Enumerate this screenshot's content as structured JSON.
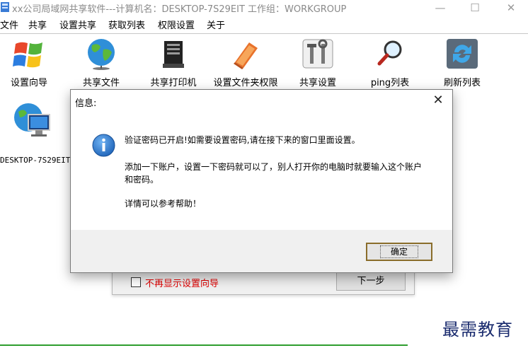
{
  "window": {
    "title": "xx公司局域网共享软件---计算机名：DESKTOP-7S29EIT   工作组：WORKGROUP",
    "minimize": "—",
    "maximize": "☐",
    "close": "✕"
  },
  "menu": [
    "文件",
    "共享",
    "设置共享",
    "获取列表",
    "权限设置",
    "关于"
  ],
  "toolbar": [
    {
      "label": "设置向导",
      "icon": "windows-logo-icon"
    },
    {
      "label": "共享文件",
      "icon": "globe-icon"
    },
    {
      "label": "共享打印机",
      "icon": "server-printer-icon"
    },
    {
      "label": "设置文件夹权限",
      "icon": "folder-book-icon"
    },
    {
      "label": "共享设置",
      "icon": "tools-icon"
    },
    {
      "label": "ping列表",
      "icon": "magnifier-icon"
    },
    {
      "label": "刷新列表",
      "icon": "refresh-icon"
    }
  ],
  "computers": [
    {
      "name": "DESKTOP-7S29EIT",
      "icon": "computer-globe-icon"
    }
  ],
  "wizard": {
    "checkbox_label": "不再显示设置向导",
    "next_label": "下一步"
  },
  "dialog": {
    "title": "信息:",
    "close": "✕",
    "icon": "info-icon",
    "line1": "验证密码已开启!如需要设置密码,请在接下来的窗口里面设置。",
    "line2": "添加一下账户，设置一下密码就可以了，别人打开你的电脑时就要输入这个账户和密码。",
    "line3": "详情可以参考帮助！",
    "ok_label": "确定"
  },
  "watermark": "最需教育",
  "colors": {
    "wizard_checkbox_text": "#e00000",
    "ok_border": "#8a6d2b",
    "info_icon": "#1e63b8",
    "watermark": "#1a2b6e"
  }
}
